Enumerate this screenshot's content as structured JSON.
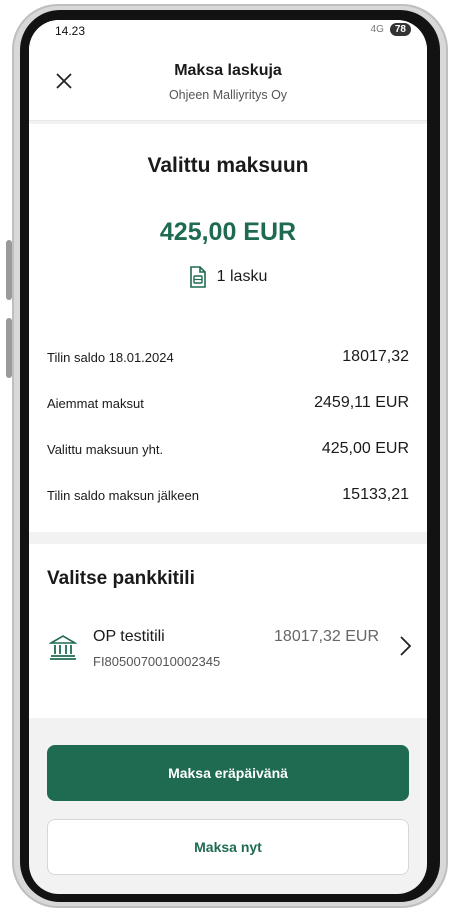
{
  "status_bar": {
    "time": "14.23",
    "battery": "78",
    "signal": "4G"
  },
  "header": {
    "title": "Maksa laskuja",
    "subtitle": "Ohjeen Malliyritys Oy",
    "close_icon": "close-icon"
  },
  "summary": {
    "title": "Valittu maksuun",
    "amount": "425,00 EUR",
    "invoice_count_label": "1 lasku",
    "rows": [
      {
        "label": "Tilin saldo 18.01.2024",
        "value": "18017,32"
      },
      {
        "label": "Aiemmat maksut",
        "value": "2459,11 EUR"
      },
      {
        "label": "Valittu maksuun yht.",
        "value": "425,00 EUR"
      },
      {
        "label": "Tilin saldo maksun jälkeen",
        "value": "15133,21"
      }
    ]
  },
  "account": {
    "section_title": "Valitse pankkitili",
    "name": "OP testitili",
    "iban": "FI8050070010002345",
    "balance": "18017,32 EUR"
  },
  "actions": {
    "pay_due_date": "Maksa eräpäivänä",
    "pay_now": "Maksa nyt"
  },
  "colors": {
    "brand_green": "#1f6b52",
    "background": "#f2f2f2"
  }
}
